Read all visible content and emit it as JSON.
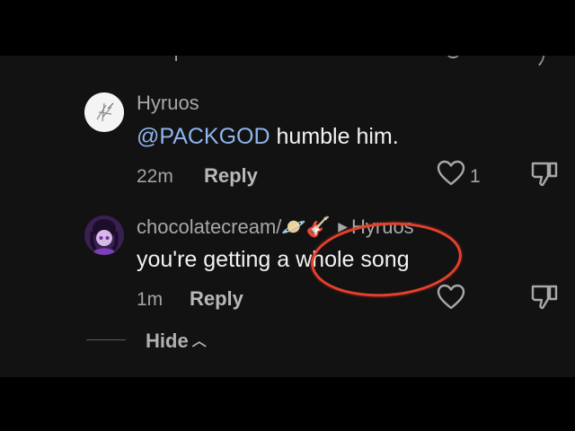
{
  "colors": {
    "background": "#121212",
    "letterbox": "#000000",
    "username": "#a8a8a8",
    "comment_text": "#f2f2f2",
    "mention": "#8fb4ee",
    "highlight_ring": "#e4412d"
  },
  "comments": [
    {
      "username": "Hyruos",
      "mention": "@PACKGOD",
      "text": " humble him.",
      "time": "22m",
      "reply_label": "Reply",
      "like_count": "1",
      "avatar_icon": "white-sketch-avatar-icon"
    },
    {
      "username": "chocolatecream/",
      "username_emoji": "🪐🎸",
      "reply_to": "Hyruos",
      "text_before": "you're getting a ",
      "text_highlighted": "whole song",
      "time": "1m",
      "reply_label": "Reply",
      "avatar_icon": "purple-anime-avatar-icon"
    }
  ],
  "hide_label": "Hide"
}
